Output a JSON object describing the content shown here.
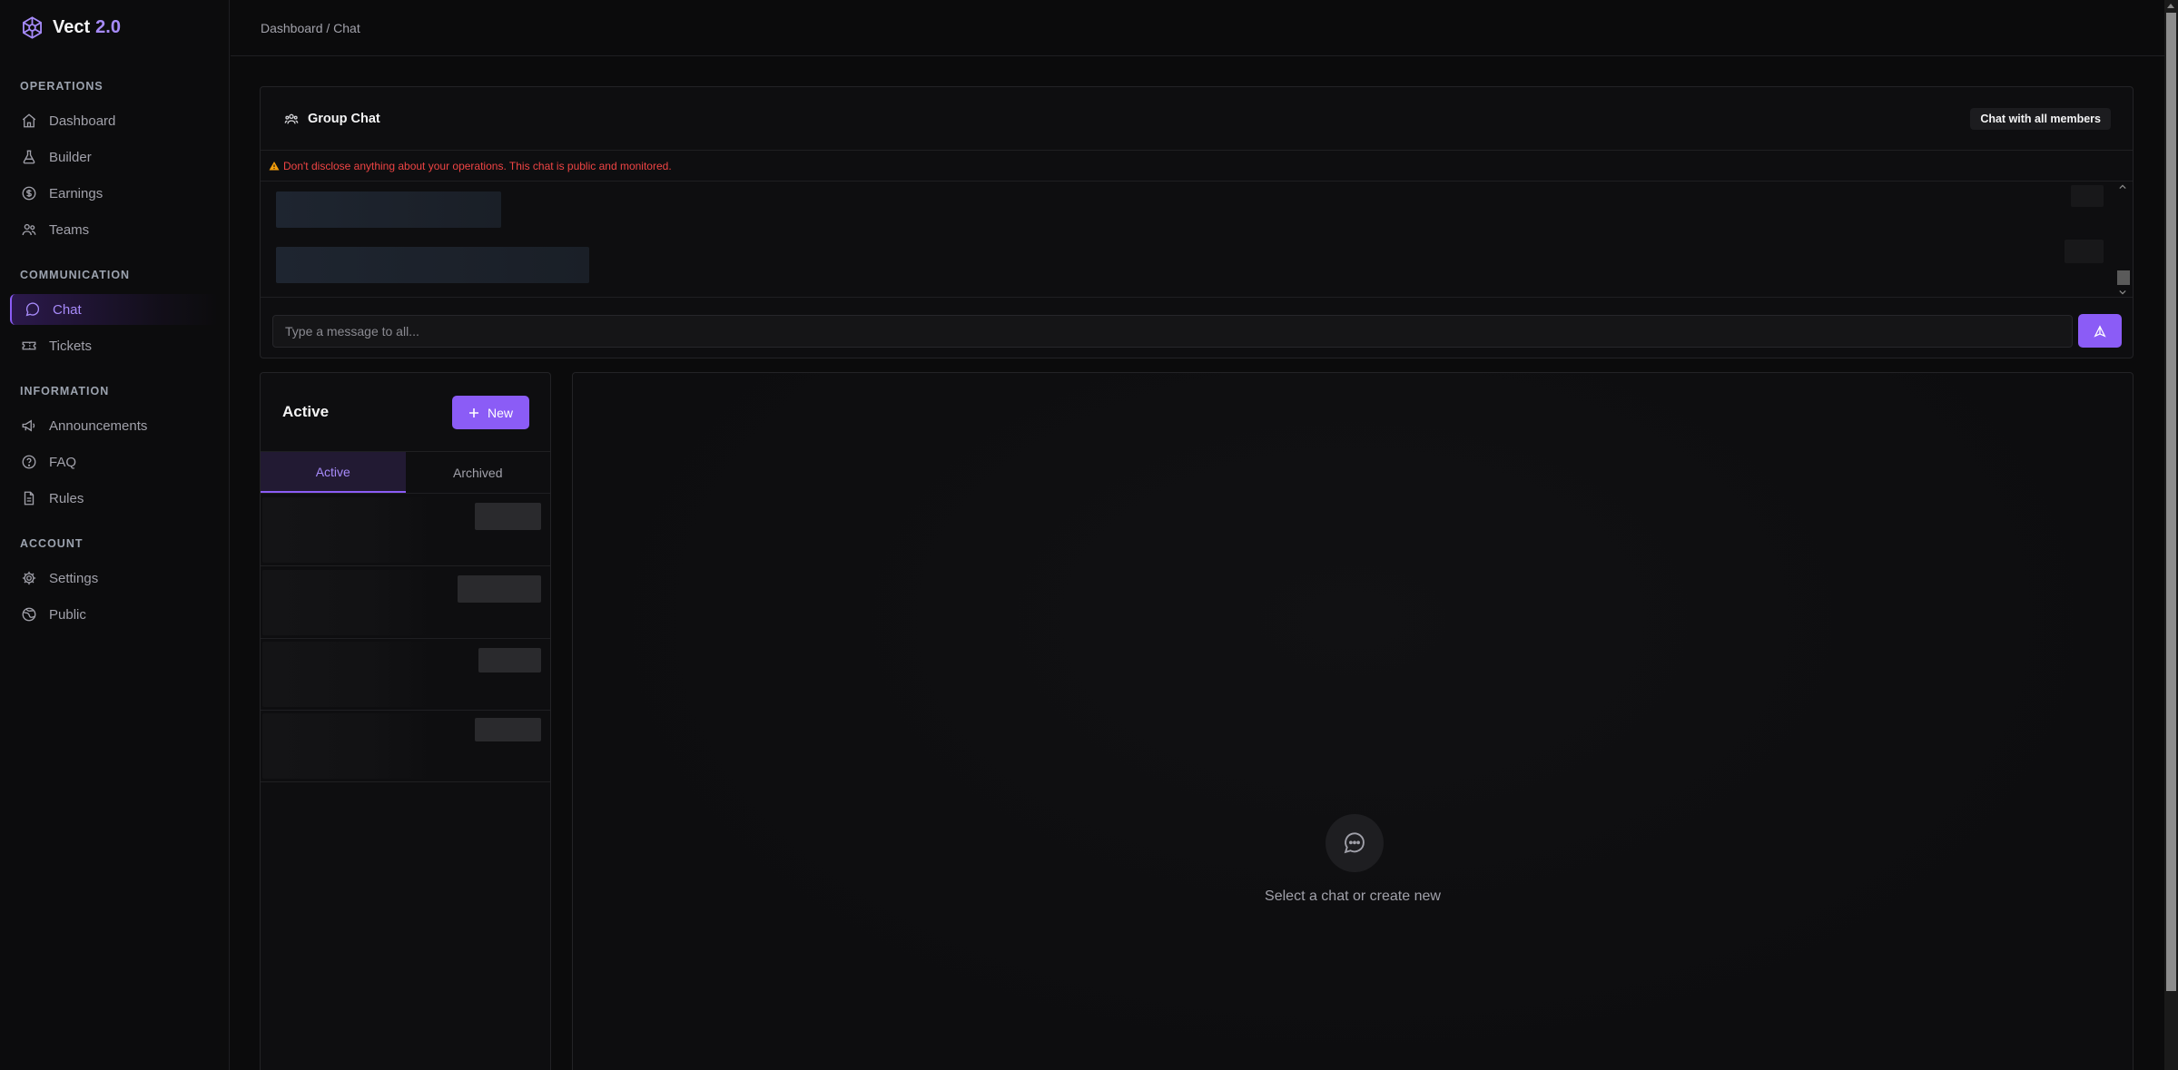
{
  "brand": {
    "name": "Vect",
    "version": "2.0"
  },
  "sidebar": {
    "sections": [
      {
        "title": "OPERATIONS",
        "items": [
          {
            "label": "Dashboard",
            "icon": "home-icon"
          },
          {
            "label": "Builder",
            "icon": "flask-icon"
          },
          {
            "label": "Earnings",
            "icon": "dollar-circle-icon"
          },
          {
            "label": "Teams",
            "icon": "users-icon"
          }
        ]
      },
      {
        "title": "COMMUNICATION",
        "items": [
          {
            "label": "Chat",
            "icon": "message-circle-icon",
            "active": true
          },
          {
            "label": "Tickets",
            "icon": "ticket-icon"
          }
        ]
      },
      {
        "title": "INFORMATION",
        "items": [
          {
            "label": "Announcements",
            "icon": "megaphone-icon"
          },
          {
            "label": "FAQ",
            "icon": "help-circle-icon"
          },
          {
            "label": "Rules",
            "icon": "file-text-icon"
          }
        ]
      },
      {
        "title": "ACCOUNT",
        "items": [
          {
            "label": "Settings",
            "icon": "gear-icon"
          },
          {
            "label": "Public",
            "icon": "globe-icon"
          }
        ]
      }
    ]
  },
  "header": {
    "breadcrumb": "Dashboard / Chat"
  },
  "group_chat": {
    "title": "Group Chat",
    "badge": "Chat with all members",
    "warning": "Don't disclose anything about your operations. This chat is public and monitored.",
    "input_placeholder": "Type a message to all..."
  },
  "tickets": {
    "title": "Active",
    "new_button": "New",
    "tabs": [
      "Active",
      "Archived"
    ],
    "active_tab": "Active"
  },
  "detail": {
    "empty_text": "Select a chat or create new"
  },
  "colors": {
    "accent": "#8b5cf6",
    "accent_light": "#a78bfa",
    "warning": "#ef4444",
    "background": "#0b0b0c"
  }
}
